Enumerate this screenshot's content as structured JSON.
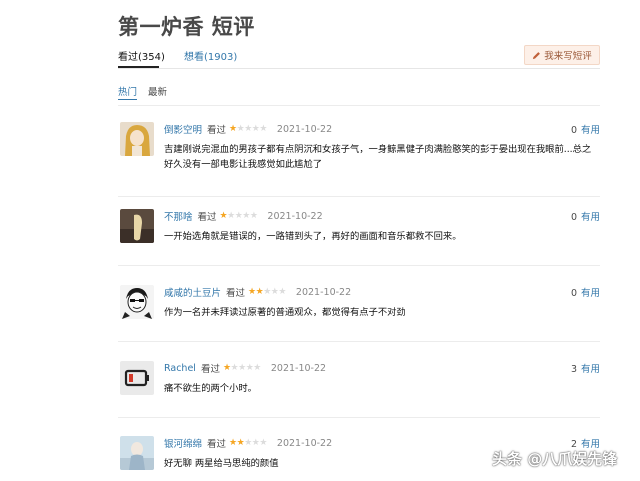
{
  "page": {
    "title": "第一炉香 短评",
    "tabs": [
      {
        "label": "看过(354)"
      },
      {
        "label": "想看(1903)"
      }
    ],
    "write_button": {
      "label": "我来写短评",
      "icon": "pencil-icon"
    },
    "sort": [
      {
        "label": "热门"
      },
      {
        "label": "最新"
      }
    ]
  },
  "reviews": [
    {
      "user": "倒影空明",
      "status": "看过",
      "rating": 1,
      "date": "2021-10-22",
      "useful_count": "0",
      "useful_label": "有用",
      "text": "吉建刚说完混血的男孩子都有点阴沉和女孩子气，一身鲸黑健子肉满脸憨笑的彭于晏出现在我眼前...总之好久没有一部电影让我感觉如此尴尬了"
    },
    {
      "user": "不那啥",
      "status": "看过",
      "rating": 1,
      "date": "2021-10-22",
      "useful_count": "0",
      "useful_label": "有用",
      "text": "一开始选角就是错误的，一路错到头了，再好的画面和音乐都救不回来。"
    },
    {
      "user": "咸咸的土豆片",
      "status": "看过",
      "rating": 2,
      "date": "2021-10-22",
      "useful_count": "0",
      "useful_label": "有用",
      "text": "作为一名并未拜读过原著的普通观众，都觉得有点子不对劲"
    },
    {
      "user": "Rachel",
      "status": "看过",
      "rating": 1,
      "date": "2021-10-22",
      "useful_count": "3",
      "useful_label": "有用",
      "text": "痛不欲生的两个小时。"
    },
    {
      "user": "银河绵绵",
      "status": "看过",
      "rating": 2,
      "date": "2021-10-22",
      "useful_count": "2",
      "useful_label": "有用",
      "text": "好无聊 两星给马思纯的颜值"
    }
  ],
  "watermark": "头条 @八爪娱先锋"
}
